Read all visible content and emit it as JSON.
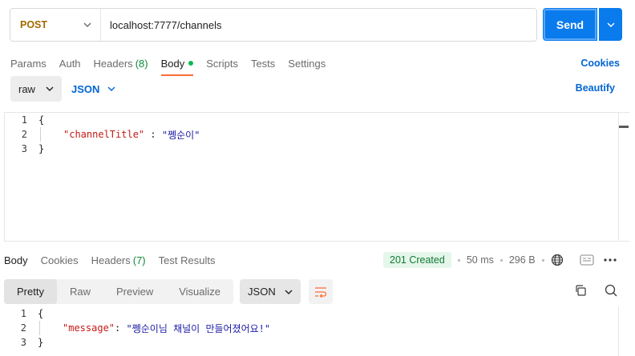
{
  "request": {
    "method": "POST",
    "url": "localhost:7777/channels",
    "send_label": "Send"
  },
  "request_tabs": [
    {
      "label": "Params"
    },
    {
      "label": "Auth"
    },
    {
      "label": "Headers",
      "count": "(8)"
    },
    {
      "label": "Body"
    },
    {
      "label": "Scripts"
    },
    {
      "label": "Tests"
    },
    {
      "label": "Settings"
    }
  ],
  "cookies_label": "Cookies",
  "body_mode": {
    "type": "raw",
    "format": "JSON",
    "beautify_label": "Beautify"
  },
  "request_body": {
    "line_numbers": [
      "1",
      "2",
      "3"
    ],
    "open_brace": "{",
    "key": "\"channelTitle\"",
    "colon": " : ",
    "value": "\"쩽순이\"",
    "close_brace": "}"
  },
  "response_tabs": [
    {
      "label": "Body"
    },
    {
      "label": "Cookies"
    },
    {
      "label": "Headers",
      "count": "(7)"
    },
    {
      "label": "Test Results"
    }
  ],
  "response_status": {
    "status": "201 Created",
    "time": "50 ms",
    "size": "296 B"
  },
  "response_view": {
    "options": [
      "Pretty",
      "Raw",
      "Preview",
      "Visualize"
    ],
    "format": "JSON"
  },
  "response_body": {
    "line_numbers": [
      "1",
      "2",
      "3"
    ],
    "open_brace": "{",
    "key": "\"message\"",
    "colon": ": ",
    "value": "\"쩽순이님 채널이 만들어졌어요!\"",
    "close_brace": "}"
  },
  "colors": {
    "accent_blue": "#097bed",
    "link_blue": "#0265d2",
    "method_color": "#a26a00",
    "active_tab_underline": "#ff6c37",
    "status_green": "#0f7a35"
  }
}
